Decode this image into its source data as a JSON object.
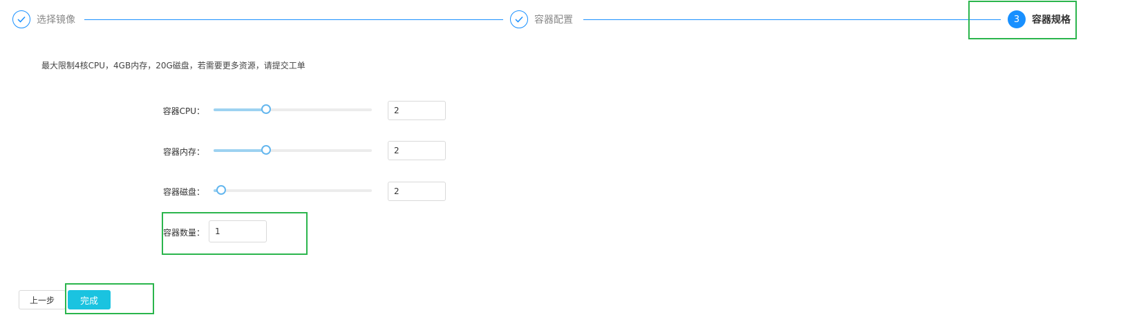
{
  "steps": [
    {
      "title": "选择镜像",
      "status": "done",
      "icon": "check-icon"
    },
    {
      "title": "容器配置",
      "status": "done",
      "icon": "check-icon"
    },
    {
      "title": "容器规格",
      "status": "active",
      "number": "3"
    }
  ],
  "info_text": "最大限制4核CPU，4GB内存，20G磁盘，若需要更多资源，请提交工单",
  "form": {
    "cpu": {
      "label": "容器CPU：",
      "value": "2",
      "slider_level": 0.33
    },
    "memory": {
      "label": "容器内存：",
      "value": "2",
      "slider_level": 0.33
    },
    "disk": {
      "label": "容器磁盘：",
      "value": "2",
      "slider_level": 0.05
    },
    "count": {
      "label": "容器数量：",
      "value": "1"
    }
  },
  "buttons": {
    "prev": "上一步",
    "finish": "完成"
  },
  "colors": {
    "primary": "#1890ff",
    "finish_button": "#1ac3e0",
    "slider_fill": "#9dd2f1",
    "highlight": "#2ab54c"
  }
}
